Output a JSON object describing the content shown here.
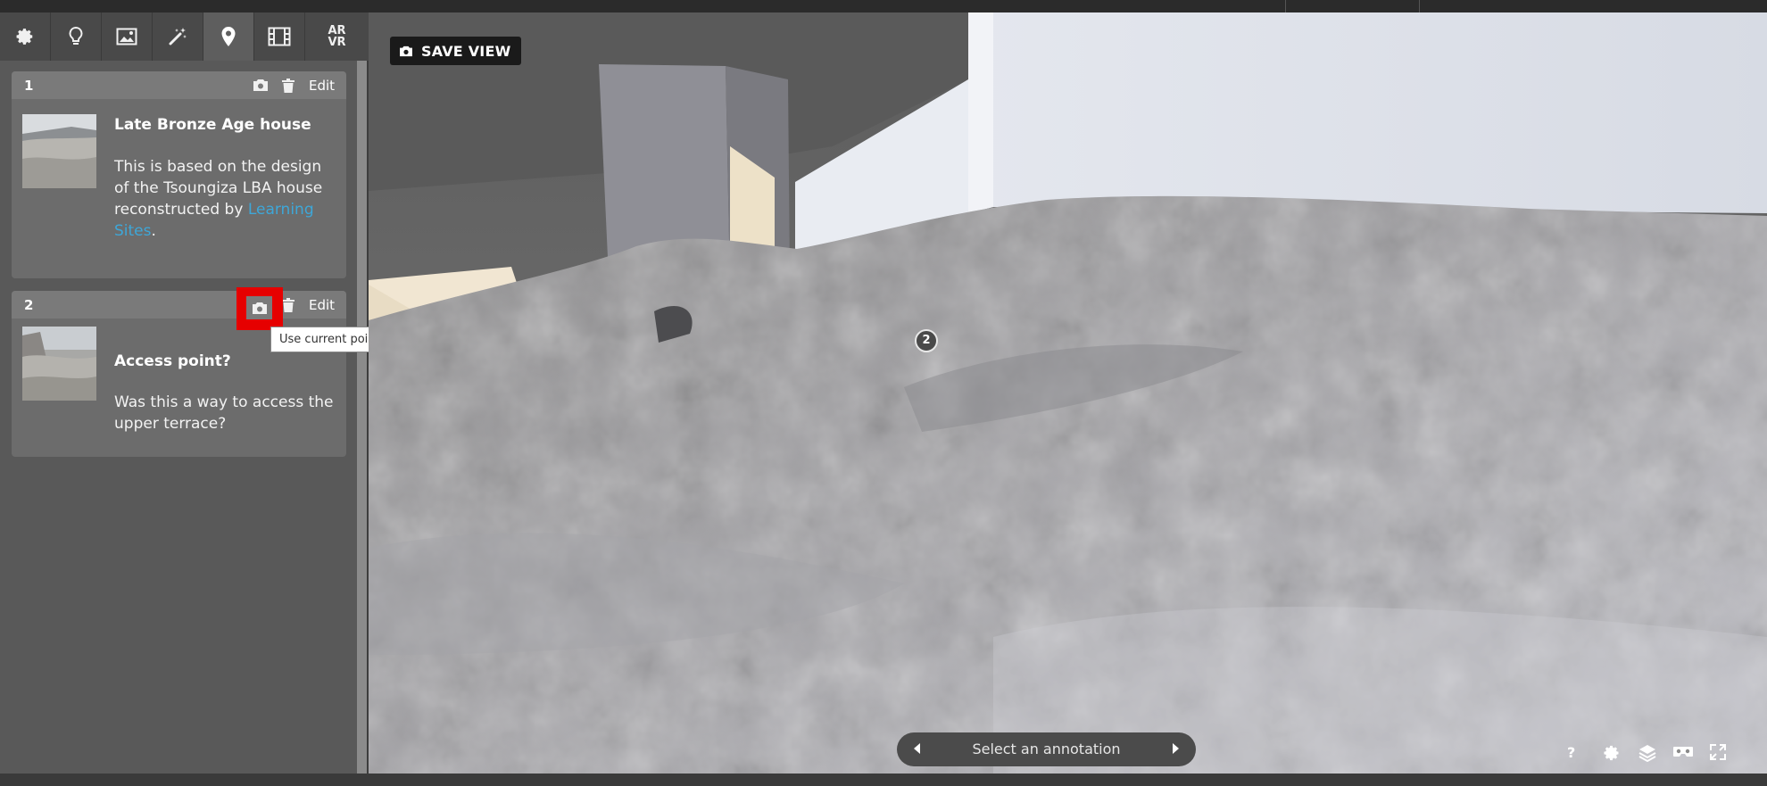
{
  "toolbar": {
    "tools": [
      {
        "icon": "gear-icon"
      },
      {
        "icon": "lightbulb-icon"
      },
      {
        "icon": "image-icon"
      },
      {
        "icon": "magic-wand-icon"
      },
      {
        "icon": "map-pin-icon",
        "active": true
      },
      {
        "icon": "film-icon"
      },
      {
        "icon": "ar-vr-icon",
        "label_top": "AR",
        "label_bottom": "VR"
      }
    ]
  },
  "annotations": [
    {
      "number": "1",
      "edit_label": "Edit",
      "title": "Late Bronze Age house",
      "text_before_link": "This is based on the design of the Tsoungiza LBA house reconstructed by ",
      "link_text": "Learning Sites",
      "text_after_link": "."
    },
    {
      "number": "2",
      "edit_label": "Edit",
      "title": "Access point?",
      "text": "Was this a way to access the upper terrace?"
    }
  ],
  "tooltip": "Use current point of view",
  "viewport": {
    "save_view_label": "SAVE VIEW",
    "pin_number": "2",
    "navigator_label": "Select an annotation",
    "bottom_icons": [
      "help-icon",
      "settings-icon",
      "layers-icon",
      "vr-headset-icon",
      "fullscreen-icon"
    ]
  },
  "colors": {
    "highlight": "#e60000",
    "link": "#3ea7d8",
    "sidebar_bg": "#595959",
    "card_bg": "#6c6c6c"
  }
}
